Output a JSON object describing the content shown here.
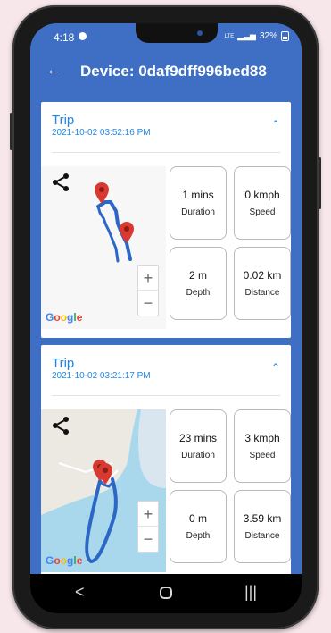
{
  "status_bar": {
    "time": "4:18",
    "network": "LTE",
    "battery_percent": "32%"
  },
  "app_bar": {
    "title": "Device: 0daf9dff996bed88"
  },
  "trips": [
    {
      "title": "Trip",
      "date": "2021-10-02 03:52:16 PM",
      "map": {
        "type": "plain"
      },
      "stats": [
        {
          "value": "1 mins",
          "label": "Duration"
        },
        {
          "value": "0 kmph",
          "label": "Speed"
        },
        {
          "value": "2 m",
          "label": "Depth"
        },
        {
          "value": "0.02 km",
          "label": "Distance"
        }
      ]
    },
    {
      "title": "Trip",
      "date": "2021-10-02 03:21:17 PM",
      "map": {
        "type": "coastal"
      },
      "stats": [
        {
          "value": "23 mins",
          "label": "Duration"
        },
        {
          "value": "3 kmph",
          "label": "Speed"
        },
        {
          "value": "0 m",
          "label": "Depth"
        },
        {
          "value": "3.59 km",
          "label": "Distance"
        }
      ]
    }
  ],
  "map_attribution": "Google",
  "zoom": {
    "plus": "+",
    "minus": "−"
  },
  "nav": {
    "back": "<",
    "recent": "|||"
  },
  "colors": {
    "accent": "#1e88e5",
    "bar": "#3f6fc4",
    "route": "#2b67c6",
    "pin": "#d83a32"
  },
  "icons": [
    "share-icon",
    "collapse-chevron-icon",
    "map-pin-icon",
    "back-arrow-icon"
  ]
}
